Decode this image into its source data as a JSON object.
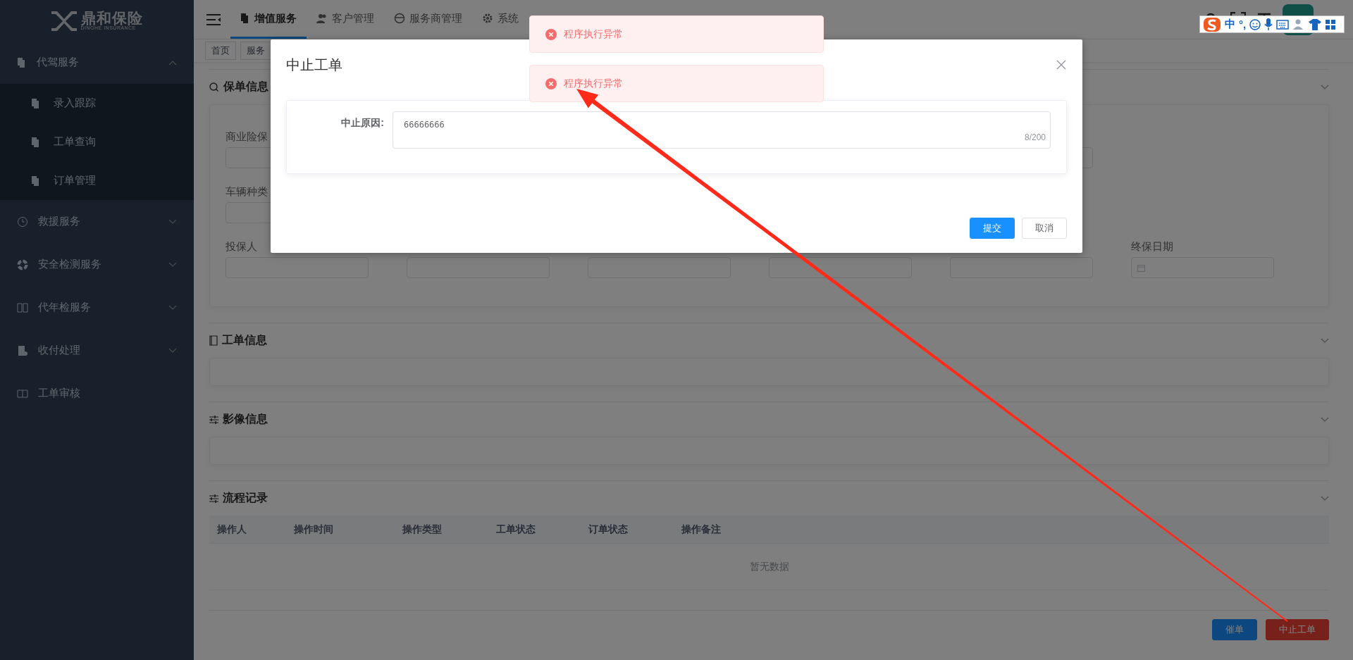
{
  "sidebar": {
    "logo": {
      "name": "鼎和保险",
      "subtitle": "DINGHE INSURANCE"
    },
    "items": [
      {
        "label": "代驾服务",
        "expanded": true,
        "children": [
          {
            "label": "录入跟踪"
          },
          {
            "label": "工单查询"
          },
          {
            "label": "订单管理"
          }
        ]
      },
      {
        "label": "救援服务",
        "expanded": false
      },
      {
        "label": "安全检测服务",
        "expanded": false
      },
      {
        "label": "代年检服务",
        "expanded": false
      },
      {
        "label": "收付处理",
        "expanded": false
      },
      {
        "label": "工单审核"
      }
    ]
  },
  "header": {
    "tabs": [
      {
        "label": "增值服务",
        "selected": true
      },
      {
        "label": "客户管理",
        "selected": false
      },
      {
        "label": "服务商管理",
        "selected": false
      },
      {
        "label": "系统",
        "selected": false
      }
    ]
  },
  "tags": [
    {
      "label": "首页"
    },
    {
      "label": "服务"
    }
  ],
  "sections": [
    {
      "title": "保单信息",
      "kind": "form",
      "rows": [
        [
          {
            "kind": "text",
            "label": "商业险保"
          },
          {
            "kind": "blank"
          },
          {
            "kind": "blank"
          },
          {
            "kind": "blank"
          },
          {
            "kind": "text"
          },
          {
            "kind": "blank"
          }
        ],
        [
          {
            "kind": "text",
            "label": "车辆种类"
          },
          {
            "kind": "blank"
          },
          {
            "kind": "blank"
          },
          {
            "kind": "blank"
          },
          {
            "kind": "blank"
          },
          {
            "kind": "blank"
          }
        ],
        [
          {
            "kind": "text",
            "label": "投保人"
          },
          {
            "kind": "text"
          },
          {
            "kind": "text"
          },
          {
            "kind": "text"
          },
          {
            "kind": "text"
          },
          {
            "kind": "date",
            "label": "终保日期"
          }
        ]
      ]
    },
    {
      "title": "工单信息",
      "kind": "empty"
    },
    {
      "title": "影像信息",
      "kind": "empty"
    },
    {
      "title": "流程记录",
      "kind": "table",
      "columns": [
        "操作人",
        "操作时间",
        "操作类型",
        "工单状态",
        "订单状态",
        "操作备注"
      ],
      "empty_text": "暂无数据"
    }
  ],
  "actions": [
    {
      "label": "催单",
      "kind": "primary"
    },
    {
      "label": "中止工单",
      "kind": "danger"
    }
  ],
  "dialog": {
    "title": "中止工单",
    "field_label": "中止原因:",
    "value": "66666666",
    "counter": "8/200",
    "buttons": [
      {
        "label": "提交",
        "kind": "primary"
      },
      {
        "label": "取消",
        "kind": "default"
      }
    ]
  },
  "messages": [
    {
      "text": "程序执行异常"
    },
    {
      "text": "程序执行异常"
    }
  ],
  "ime_toolbar": {
    "mode": "中",
    "punctuation": "°,"
  },
  "annotation": {
    "kind": "arrow"
  }
}
